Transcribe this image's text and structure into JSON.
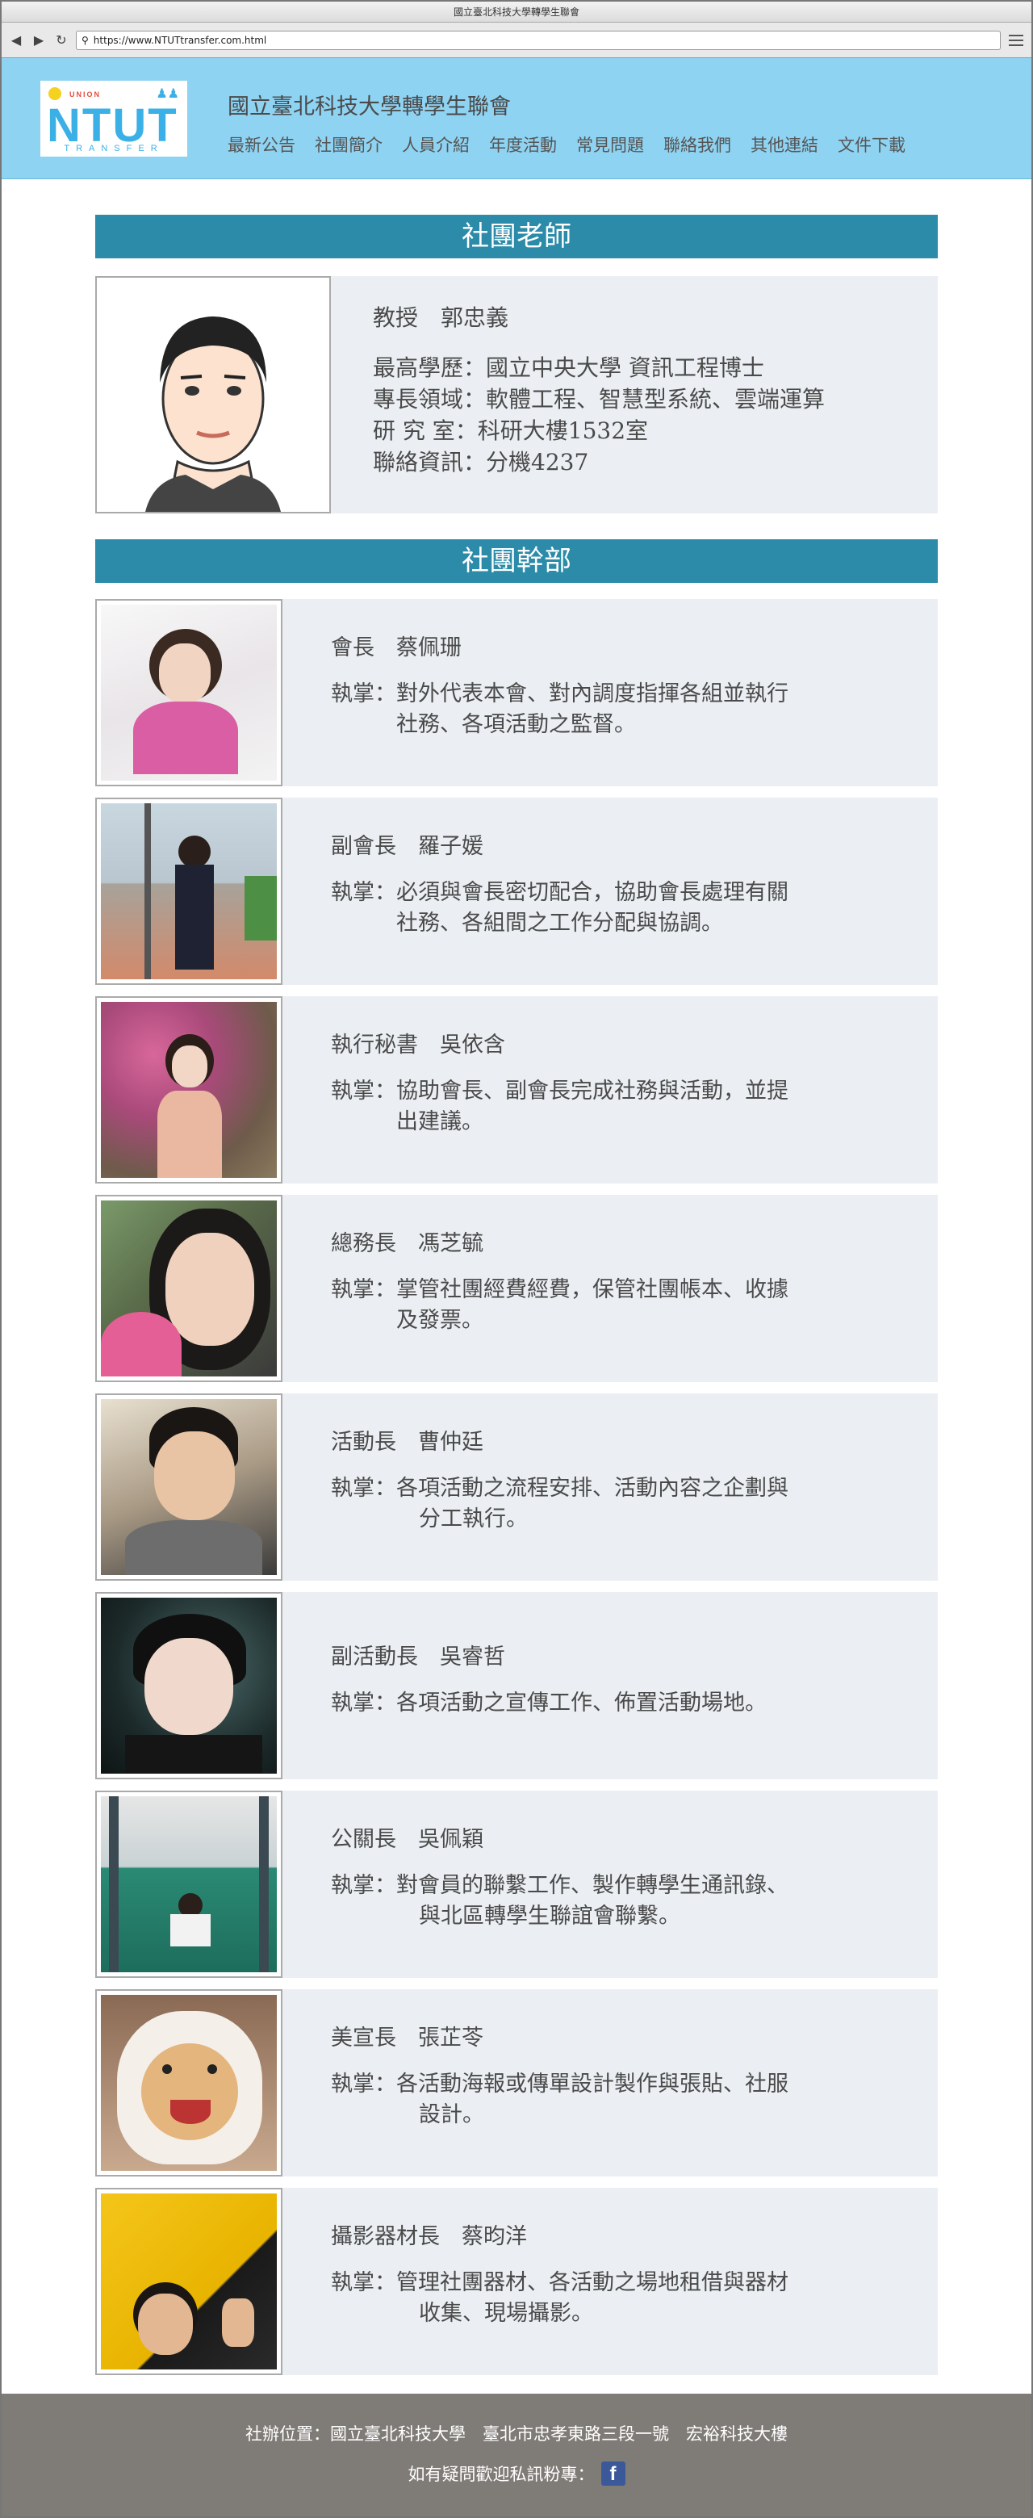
{
  "window": {
    "title": "國立臺北科技大學轉學生聯會"
  },
  "address_bar": {
    "url": "https://www.NTUTtransfer.com.html"
  },
  "header": {
    "logo": {
      "main": "NTUT",
      "sub": "TRANSFER",
      "tiny": "UNION"
    },
    "site_title": "國立臺北科技大學轉學生聯會",
    "nav": [
      "最新公告",
      "社團簡介",
      "人員介紹",
      "年度活動",
      "常見問題",
      "聯絡我們",
      "其他連結",
      "文件下載"
    ]
  },
  "teacher_section": {
    "heading": "社團老師",
    "name": "教授　郭忠義",
    "lines": [
      "最高學歷：國立中央大學 資訊工程博士",
      "專長領域：軟體工程、智慧型系統、雲端運算",
      "研 究 室：科研大樓1532室",
      "聯絡資訊：分機4237"
    ]
  },
  "staff_section": {
    "heading": "社團幹部",
    "duty_label": "執掌：",
    "members": [
      {
        "title": "會長　蔡佩珊",
        "duty_l1": "對外代表本會、對內調度指揮各組並執行",
        "duty_l2": "社務、各項活動之監督。"
      },
      {
        "title": "副會長　羅子媛",
        "duty_l1": "必須與會長密切配合，協助會長處理有關",
        "duty_l2": "社務、各組間之工作分配與協調。"
      },
      {
        "title": "執行秘書　吳依含",
        "duty_l1": "協助會長、副會長完成社務與活動，並提",
        "duty_l2": "出建議。"
      },
      {
        "title": "總務長　馮芝毓",
        "duty_l1": "掌管社團經費經費，保管社團帳本、收據",
        "duty_l2": "及發票。"
      },
      {
        "title": "活動長　曹仲廷",
        "duty_l1": "各項活動之流程安排、活動內容之企劃與",
        "duty_l2": "分工執行。"
      },
      {
        "title": "副活動長　吳睿哲",
        "duty_l1": "各項活動之宣傳工作、佈置活動場地。",
        "duty_l2": ""
      },
      {
        "title": "公關長　吳佩穎",
        "duty_l1": "對會員的聯繫工作、製作轉學生通訊錄、",
        "duty_l2": "與北區轉學生聯誼會聯繫。"
      },
      {
        "title": "美宣長　張芷苓",
        "duty_l1": "各活動海報或傳單設計製作與張貼、社服",
        "duty_l2": "設計。"
      },
      {
        "title": "攝影器材長　蔡昀洋",
        "duty_l1": "管理社團器材、各活動之場地租借與器材",
        "duty_l2": "收集、現場攝影。"
      }
    ]
  },
  "footer": {
    "address": "社辦位置：國立臺北科技大學　臺北市忠孝東路三段一號　宏裕科技大樓",
    "contact": "如有疑問歡迎私訊粉專：",
    "fb_icon": "facebook-icon"
  },
  "colors": {
    "header_bg": "#8fd3f2",
    "section_bar": "#2b8ba8",
    "card_bg": "#ebeff3",
    "footer_bg": "#7f7b77"
  }
}
